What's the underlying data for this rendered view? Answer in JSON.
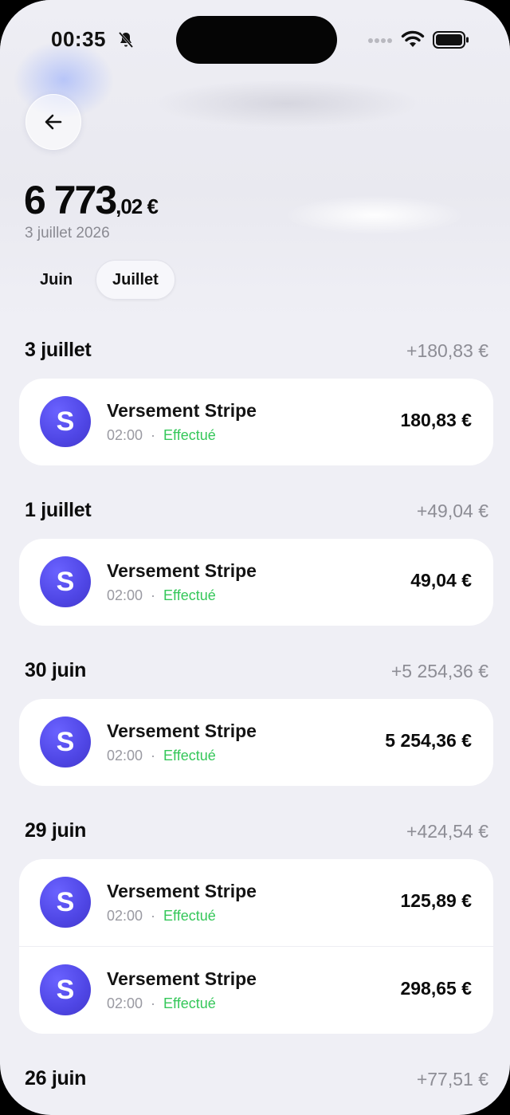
{
  "status_bar": {
    "time": "00:35"
  },
  "balance": {
    "integer": "6 773",
    "decimal": ",02 €",
    "date": "3 juillet 2026"
  },
  "tabs": [
    {
      "label": "Juin",
      "selected": false
    },
    {
      "label": "Juillet",
      "selected": true
    }
  ],
  "sections": [
    {
      "date": "3 juillet",
      "total": "+180,83 €",
      "transactions": [
        {
          "name": "Versement Stripe",
          "time": "02:00",
          "status": "Effectué",
          "amount": "180,83 €",
          "avatar_letter": "S"
        }
      ]
    },
    {
      "date": "1 juillet",
      "total": "+49,04 €",
      "transactions": [
        {
          "name": "Versement Stripe",
          "time": "02:00",
          "status": "Effectué",
          "amount": "49,04 €",
          "avatar_letter": "S"
        }
      ]
    },
    {
      "date": "30 juin",
      "total": "+5 254,36 €",
      "transactions": [
        {
          "name": "Versement Stripe",
          "time": "02:00",
          "status": "Effectué",
          "amount": "5 254,36 €",
          "avatar_letter": "S"
        }
      ]
    },
    {
      "date": "29 juin",
      "total": "+424,54 €",
      "transactions": [
        {
          "name": "Versement Stripe",
          "time": "02:00",
          "status": "Effectué",
          "amount": "125,89 €",
          "avatar_letter": "S"
        },
        {
          "name": "Versement Stripe",
          "time": "02:00",
          "status": "Effectué",
          "amount": "298,65 €",
          "avatar_letter": "S"
        }
      ]
    },
    {
      "date": "26 juin",
      "total": "+77,51 €",
      "transactions": []
    }
  ],
  "colors": {
    "avatar": "#4f46e5",
    "status_done": "#34c759",
    "background": "#efeff5"
  }
}
